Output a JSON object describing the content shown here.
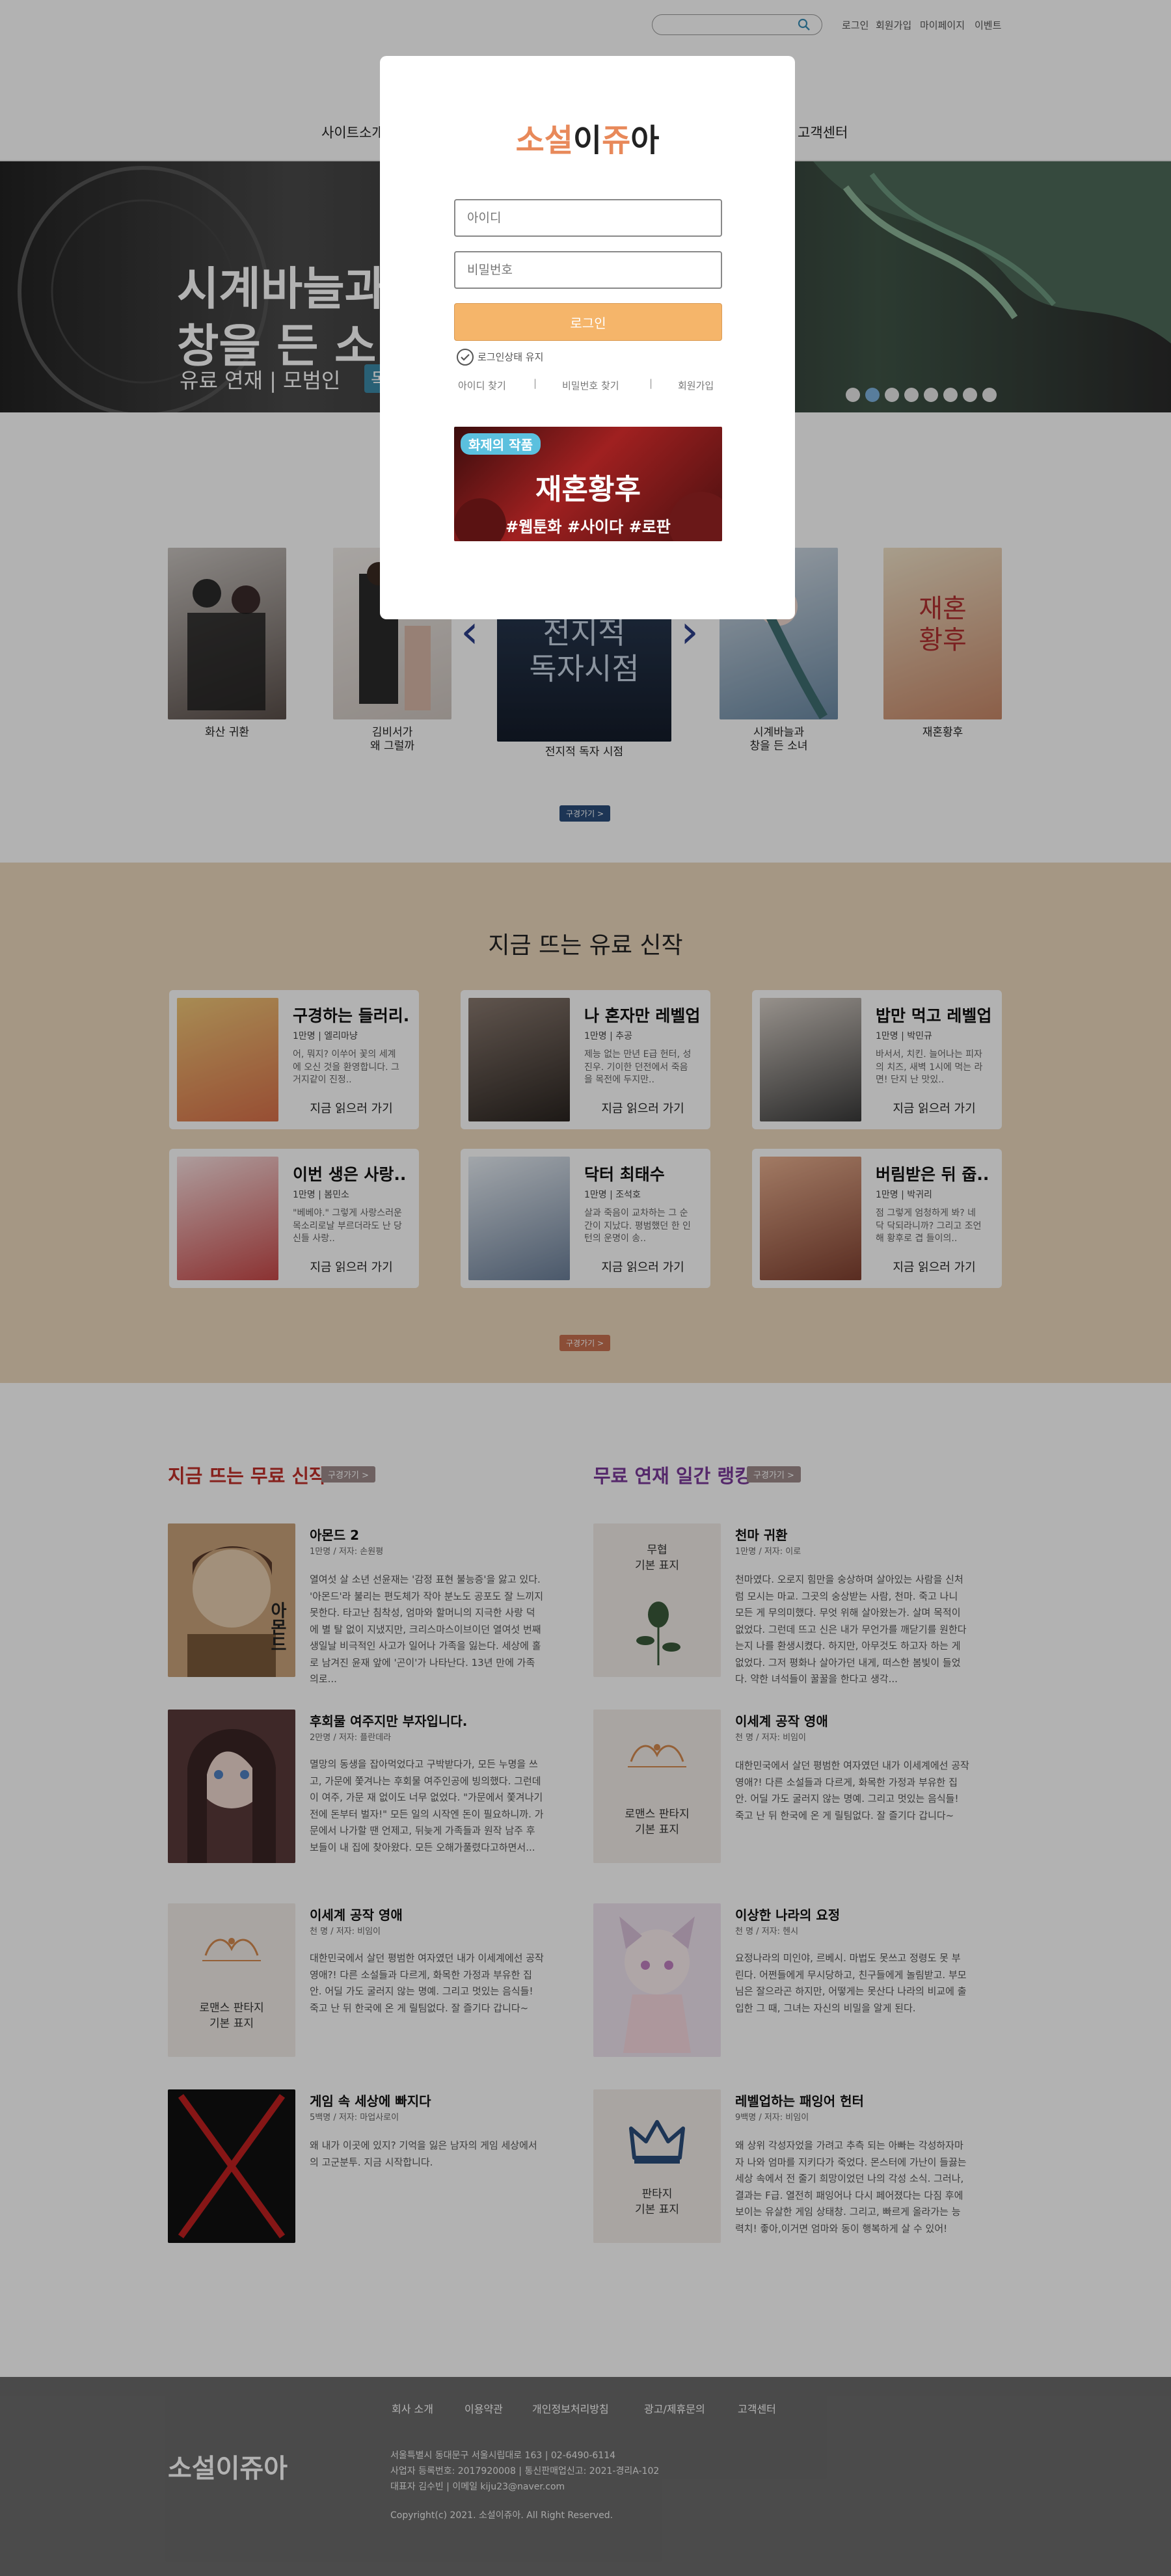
{
  "header": {
    "search": {
      "placeholder": ""
    },
    "top_links": [
      "로그인",
      "회원가입",
      "마이페이지",
      "이벤트"
    ],
    "nav": {
      "site_intro": "사이트소개",
      "customer_center": "고객센터"
    }
  },
  "hero": {
    "title_line1": "시계바늘과",
    "title_line2": "창을 든 소",
    "subtitle": "유료 연재  |  모범인",
    "badge": "독",
    "slide_count": 8,
    "active_slide": 2
  },
  "carousel": {
    "items": [
      {
        "title": "화산 귀환"
      },
      {
        "title": "김비서가\n왜 그럴까"
      },
      {
        "title": "전지적 독자 시점"
      },
      {
        "title": "시계바늘과\n창을 든 소녀"
      },
      {
        "title": "재혼황후"
      }
    ],
    "featured_cover_text": "전지적\n독자시점",
    "side_cover_text": "재혼\n황후",
    "more_button": "구경가기 >"
  },
  "paid_new": {
    "title": "지금 뜨는 유료 신작",
    "more_button": "구경가기 >",
    "cards": [
      {
        "title": "구경하는 들러리..",
        "meta": "1만명 | 엘리마냥",
        "desc": "어, 뭐지? 이쑤어 꽃의 세계에 오신 것을 환영합니다. 그 거지같이 진정..",
        "link": "지금 읽으러 가기",
        "color": "#d98a5a"
      },
      {
        "title": "나 혼자만 레벨업",
        "meta": "1만명 | 추공",
        "desc": "제능 없는 만년 E급 헌터, 성진우. 기이한 던전에서 죽음을 목전에 두지만..",
        "link": "지금 읽으러 가기",
        "color": "#5a4a45"
      },
      {
        "title": "밥만 먹고 레벨업",
        "meta": "1만명 | 박민규",
        "desc": "바서서, 치킨. 늘어나는 피자의 치즈, 새벽 1시에 먹는 라면! 단지 난 맛있..",
        "link": "지금 읽으러 가기",
        "color": "#4a4a4a"
      },
      {
        "title": "이번 생은 사랑..",
        "meta": "1만명 | 봄민소",
        "desc": "\"베베야.\" 그렇게 사랑스러운 목소리로날 부르더라도 난 당신들 사랑..",
        "link": "지금 읽으러 가기",
        "color": "#c04a4a"
      },
      {
        "title": "닥터 최태수",
        "meta": "1만명 | 조석호",
        "desc": "살과 죽음이 교차하는 그 순간이 지났다. 평범했던 한 인턴의 운명이 송..",
        "link": "지금 읽으러 가기",
        "color": "#6a7f99"
      },
      {
        "title": "버림받은 뒤 줍..",
        "meta": "1만명 | 박귀리",
        "desc": "점 그렇게 엄청하게 봐? 네 닥 닥되라니까? 그리고 조언해 황후로 겹 들이의..",
        "link": "지금 읽으러 가기",
        "color": "#a05a40"
      }
    ]
  },
  "free_new": {
    "title": "지금 뜨는 무료 신작",
    "more_button": "구경가기 >",
    "items": [
      {
        "title": "아몬드 2",
        "meta": "1만명  /  저자: 손원평",
        "desc": "열여섯 살 소년 선윤재는 '감정 표현 불능증'을 앓고 있다. '아몬드'라 불리는 편도체가 작아 분노도 공포도 잘 느끼지 못한다. 타고난 침착성, 엄마와 할머니의 지극한 사랑 덕에 별 탈 없이 지냈지만, 크리스마스이브이던 열여섯 번째 생일날 비극적인 사고가 일어나 가족을 잃는다. 세상에 홀로 남겨진 윤재 앞에 '곤이'가 나타난다. 13년 만에 가족의로...",
        "cover_text": "아몬드",
        "color": "#c9a37a"
      },
      {
        "title": "후회물 여주지만 부자입니다.",
        "meta": "2만명  /  저자: 플란데라",
        "desc": "멸망의 동생을 잡아먹었다고 구박받다가, 모든 누명을 쓰고, 가문에 쫓겨나는 후회물 여주인공에 빙의했다. 그런데 이 여주, 가문 재 없이도 너무 없었다. \"가문에서 쫓겨나기 전에 돈부터 벌자!\" 모든 일의 시작엔 돈이 필요하니까. 가문에서 나가할 땐 언제고, 뒤늦게 가족들과 원작 남주 후보들이 내 집에 찾아왔다. 모든 오해가풀렸다고하면서...",
        "color": "#5a3a3a"
      },
      {
        "title": "이세계 공작 영애",
        "meta": "천 명  /  저자: 비임이",
        "desc": "대한민국에서 살던 평범한 여자였던 내가 이세계에선 공작영애?! 다른 소설들과 다르게, 화목한 가정과 부유한 집안. 어딜 가도 굴러지 않는 명예. 그리고 멋있는 음식들! 죽고 난 뒤 한국에 온 게 릴팀없다. 잘 즐기다 갑니다~",
        "default_label": "로맨스 판타지\n기본 표지"
      },
      {
        "title": "게임 속 세상에 빠지다",
        "meta": "5백명  /  저자: 마업사로이",
        "desc": "왜 내가 이곳에 있지? 기억을 잃은 남자의 게임 세상에서의 고군분투. 지금 시작합니다.",
        "color": "#111111"
      }
    ]
  },
  "free_ranking": {
    "title": "무료 연재 일간 랭킹",
    "more_button": "구경가기 >",
    "items": [
      {
        "title": "천마 귀환",
        "meta": "1만명  /  저자: 이로",
        "desc": "천마였다. 오로지 힘만을 숭상하며 살아있는 사람을 신처럼 모시는 마교. 그곳의 숭상받는 사람, 천마. 죽고 나니 모든 게 무의미했다. 무엇 위해 살아왔는가. 살며 목적이 없었다. 그런데 뜨고 신은 내가 무언가를 깨닫기를 원한다는지 나를 환생시켰다. 하지만, 아무것도 하고자 하는 게 없었다. 그저 평화나 살아가던 내게, 떠스한 봄빛이 들었다. 약한 녀석들이 꿀꿀을 한다고 생각...",
        "default_label": "무협\n기본 표지"
      },
      {
        "title": "이세계 공작 영애",
        "meta": "천 명  /  저자: 비임이",
        "desc": "대한민국에서 살던 평범한 여자였던 내가 이세계에선 공작영애?! 다른 소설들과 다르게, 화목한 가정과 부유한 집안. 어딜 가도 굴러지 않는 명예. 그리고 멋있는 음식들! 죽고 난 뒤 한국에 온 게 릴팀없다. 잘 즐기다 갑니다~",
        "default_label": "로맨스 판타지\n기본 표지"
      },
      {
        "title": "이상한 나라의 요정",
        "meta": "천 명  /  저자: 헨시",
        "desc": "요정나라의 미인야, 르베시. 마법도 못쓰고 정령도 못 부린다. 어쩐들에게 무시당하고, 친구들에게 놀림받고. 부모님은 잘으라곤 하지만, 어떻게는 못산다 나라의 비교에 출입한 그 때, 그녀는 자신의 비밀을 알게 된다.",
        "color": "#f0e4ef"
      },
      {
        "title": "레벨업하는 패잉어 헌터",
        "meta": "9백명  /  저자: 비임이",
        "desc": "왜 상위 각성자었을 가려고 추측 되는 아빠는 각성하자마자 나와 엄마를 지키다가 죽었다. 몬스터에 가난이 들끓는 세상 속에서 전 줄기 희망이었던 나의 각성 소식. 그러나, 결과는 F급. 열전히 패잉어나 다시 페어졌다는 다짐 후에 보이는 유살한 게임 상태창. 그리고, 빠르게 올라가는 능력치! 좋아,이거면 엄마와 동이 행복하게 살 수 있어!",
        "default_label": "판타지\n기본 표지"
      }
    ]
  },
  "footer": {
    "links": [
      "회사 소개",
      "이용약관",
      "개인정보처리방침",
      "광고/제휴문의",
      "고객센터"
    ],
    "logo": "소설이쥬아",
    "info_line1": "서울특별시 동대문구 서울시립대로 163   |   02-6490-6114",
    "info_line2": "사업자 등록번호: 2017920008   |   통신판매업신고: 2021-경리A-102",
    "info_line3": "대표자 김수빈 | 이메일 kiju23@naver.com",
    "copyright": "Copyright(c) 2021. 소설이쥬아.  All Right Reserved."
  },
  "login_modal": {
    "logo_part1": "소설",
    "logo_part2": "이",
    "logo_part3": "쥬",
    "logo_part4": "아",
    "id_placeholder": "아이디",
    "pw_placeholder": "비밀번호",
    "login_button": "로그인",
    "remember_label": "로그인상태 유지",
    "find_id": "아이디 찾기",
    "find_pw": "비밀번호 찾기",
    "signup": "회원가입",
    "separator": "|",
    "promo": {
      "badge": "화제의 작품",
      "title": "재혼황후",
      "tags": "#웹툰화 #사이다 #로판"
    },
    "colors": {
      "accent": "#e8895a",
      "button": "#f5b56a"
    }
  }
}
